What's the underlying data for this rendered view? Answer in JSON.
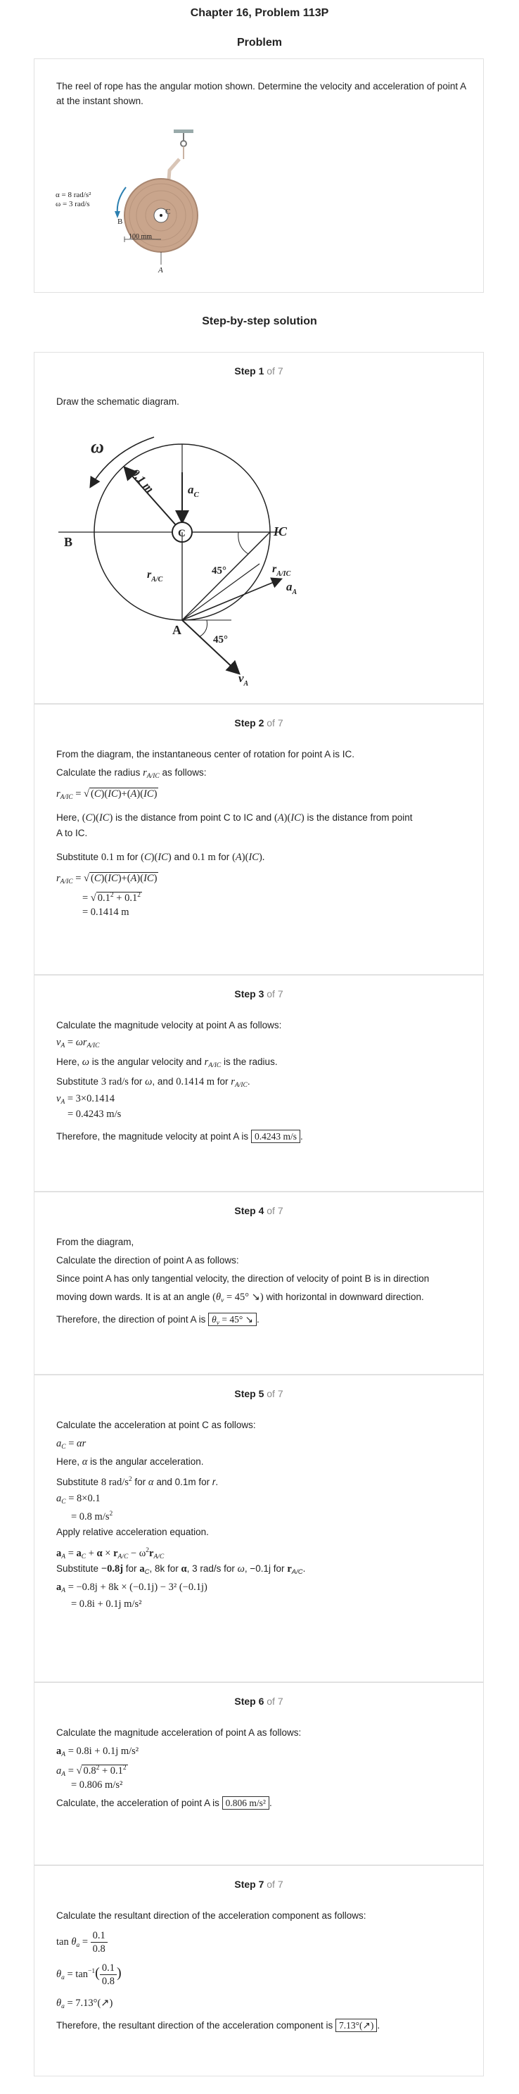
{
  "header": {
    "chapter_title": "Chapter 16, Problem 113P",
    "problem_label": "Problem",
    "solution_label": "Step-by-step solution"
  },
  "problem": {
    "text": "The reel of rope has the angular motion shown. Determine the velocity and acceleration of point A at the instant shown.",
    "fig_alpha": "α = 8 rad/s²",
    "fig_omega": "ω = 3 rad/s",
    "fig_B": "B",
    "fig_C": "C",
    "fig_A": "A",
    "fig_dim": "100 mm"
  },
  "steps": [
    {
      "num": "Step 1",
      "of": "of 7",
      "text": "Draw the schematic diagram.",
      "fig": {
        "omega": "ω",
        "radius": "0.1 m",
        "ac": "a",
        "ac_sub": "C",
        "C": "C",
        "B": "B",
        "A": "A",
        "IC": "IC",
        "rac": "r",
        "rac_sub": "A/C",
        "raic": "r",
        "raic_sub": "A/IC",
        "aA": "a",
        "aA_sub": "A",
        "vA": "v",
        "vA_sub": "A",
        "ang1": "45°",
        "ang2": "45°"
      }
    },
    {
      "num": "Step 2",
      "of": "of 7",
      "l1": "From the diagram, the instantaneous center of rotation for point A is IC.",
      "l2": "Calculate the radius",
      "l2b": "as follows:",
      "l3": "Here,",
      "l3b": "is the distance from point C to IC and",
      "l3c": "is the distance from point",
      "l3d": "A to IC.",
      "l4": "Substitute",
      "l4v1": "0.1 m",
      "l4b": "for",
      "l4c": "and",
      "l4v2": "0.1 m",
      "l4d": "for",
      "res2": "= 0.1414 m"
    },
    {
      "num": "Step 3",
      "of": "of 7",
      "l1": "Calculate the magnitude velocity at point A as follows:",
      "l2": "Here,",
      "l2b": "is the angular velocity and",
      "l2c": "is the radius.",
      "l3": "Substitute",
      "l3v1": "3 rad/s",
      "l3b": "for",
      "l3c": ", and",
      "l3v2": "0.1414 m",
      "l3d": "for",
      "calc1": "= 3×0.1414",
      "calc2": "= 0.4243 m/s",
      "l4": "Therefore, the magnitude velocity at point A is",
      "ans": "0.4243 m/s"
    },
    {
      "num": "Step 4",
      "of": "of 7",
      "l1": "From the diagram,",
      "l2": "Calculate the direction of point A as follows:",
      "l3": "Since point A has only tangential velocity, the direction of velocity of point B is in direction",
      "l4": "moving down wards. It is at an angle",
      "l4b": "with horizontal in downward direction.",
      "l5": "Therefore, the direction of point A is",
      "angle": "= 45°"
    },
    {
      "num": "Step 5",
      "of": "of 7",
      "l1": "Calculate the acceleration at point C as follows:",
      "l2": "Here,",
      "l2b": "is the angular acceleration.",
      "l3": "Substitute",
      "l3v1": "8 rad/s",
      "l3b": "for",
      "l3c": "and 0.1m for",
      "calc1": "= 8×0.1",
      "calc2": "= 0.8 m/s",
      "l4": "Apply relative acceleration equation.",
      "l5": "Substitute",
      "l5v1": "−0.8j",
      "l5b": "for",
      "l5c": ", 8k for",
      "l5d": ", 3 rad/s for",
      "l5e": ", −0.1j for",
      "calc3": "= −0.8j + 8k × (−0.1j) − 3² (−0.1j)",
      "calc4": "= 0.8i + 0.1j m/s²"
    },
    {
      "num": "Step 6",
      "of": "of 7",
      "l1": "Calculate the magnitude acceleration of point A as follows:",
      "calc1": "= 0.8i + 0.1j m/s²",
      "calc2": "= 0.806 m/s²",
      "l2": "Calculate, the acceleration of point A is",
      "ans": "0.806 m/s²"
    },
    {
      "num": "Step 7",
      "of": "of 7",
      "l1": "Calculate the resultant direction of the acceleration component as follows:",
      "res": "= 7.13°(↗)",
      "l2": "Therefore, the resultant direction of the acceleration component is",
      "ans": "7.13°(↗)"
    }
  ]
}
